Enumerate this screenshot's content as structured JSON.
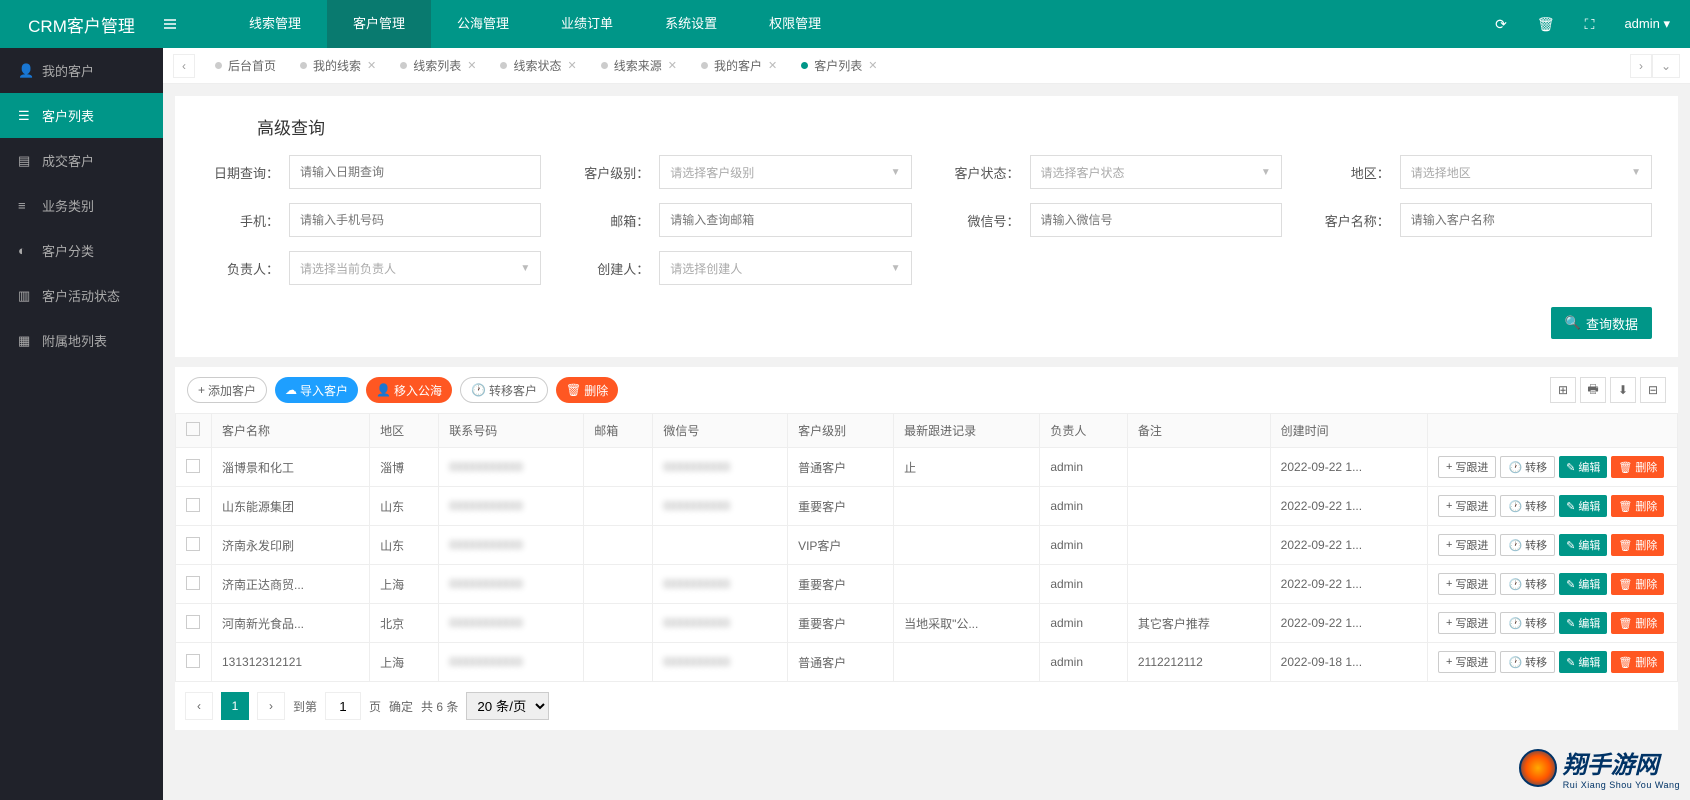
{
  "brand": "CRM客户管理",
  "topNav": [
    "线索管理",
    "客户管理",
    "公海管理",
    "业绩订单",
    "系统设置",
    "权限管理"
  ],
  "topNavActive": 1,
  "admin": "admin ▾",
  "sidebar": [
    {
      "icon": "user",
      "label": "我的客户"
    },
    {
      "icon": "list",
      "label": "客户列表"
    },
    {
      "icon": "deal",
      "label": "成交客户"
    },
    {
      "icon": "biz",
      "label": "业务类别"
    },
    {
      "icon": "cat",
      "label": "客户分类"
    },
    {
      "icon": "activity",
      "label": "客户活动状态"
    },
    {
      "icon": "attach",
      "label": "附属地列表"
    }
  ],
  "sidebarActive": 1,
  "tabs": [
    "后台首页",
    "我的线索",
    "线索列表",
    "线索状态",
    "线索来源",
    "我的客户",
    "客户列表"
  ],
  "tabActive": 6,
  "search": {
    "title": "高级查询",
    "fields": {
      "date": {
        "label": "日期查询：",
        "ph": "请输入日期查询"
      },
      "level": {
        "label": "客户级别：",
        "ph": "请选择客户级别"
      },
      "status": {
        "label": "客户状态：",
        "ph": "请选择客户状态"
      },
      "region": {
        "label": "地区：",
        "ph": "请选择地区"
      },
      "phone": {
        "label": "手机：",
        "ph": "请输入手机号码"
      },
      "email": {
        "label": "邮箱：",
        "ph": "请输入查询邮箱"
      },
      "wechat": {
        "label": "微信号：",
        "ph": "请输入微信号"
      },
      "name": {
        "label": "客户名称：",
        "ph": "请输入客户名称"
      },
      "owner": {
        "label": "负责人：",
        "ph": "请选择当前负责人"
      },
      "creator": {
        "label": "创建人：",
        "ph": "请选择创建人"
      }
    },
    "searchBtn": "查询数据"
  },
  "toolbar": {
    "add": "添加客户",
    "import": "导入客户",
    "toPublic": "移入公海",
    "transfer": "转移客户",
    "delete": "删除"
  },
  "table": {
    "headers": [
      "客户名称",
      "地区",
      "联系号码",
      "邮箱",
      "微信号",
      "客户级别",
      "最新跟进记录",
      "负责人",
      "备注",
      "创建时间"
    ],
    "rows": [
      {
        "name": "淄博景和化工",
        "region": "淄博",
        "phone": "···",
        "email": "",
        "wechat": "···",
        "level": "普通客户",
        "follow": "止",
        "owner": "admin",
        "remark": "",
        "created": "2022-09-22 1..."
      },
      {
        "name": "山东能源集团",
        "region": "山东",
        "phone": "···",
        "email": "",
        "wechat": "···",
        "level": "重要客户",
        "follow": "",
        "owner": "admin",
        "remark": "",
        "created": "2022-09-22 1..."
      },
      {
        "name": "济南永发印刷",
        "region": "山东",
        "phone": "···",
        "email": "",
        "wechat": "",
        "level": "VIP客户",
        "follow": "",
        "owner": "admin",
        "remark": "",
        "created": "2022-09-22 1..."
      },
      {
        "name": "济南正达商贸...",
        "region": "上海",
        "phone": "···",
        "email": "",
        "wechat": "···",
        "level": "重要客户",
        "follow": "",
        "owner": "admin",
        "remark": "",
        "created": "2022-09-22 1..."
      },
      {
        "name": "河南新光食品...",
        "region": "北京",
        "phone": "···",
        "email": "",
        "wechat": "···",
        "level": "重要客户",
        "follow": "当地采取\"公...",
        "owner": "admin",
        "remark": "其它客户推荐",
        "created": "2022-09-22 1..."
      },
      {
        "name": "131312312121",
        "region": "上海",
        "phone": "···",
        "email": "",
        "wechat": "···",
        "level": "普通客户",
        "follow": "",
        "owner": "admin",
        "remark": "2112212112",
        "created": "2022-09-18 1..."
      }
    ],
    "actions": {
      "follow": "写跟进",
      "transfer": "转移",
      "edit": "编辑",
      "delete": "删除"
    }
  },
  "pagination": {
    "current": "1",
    "goto": "到第",
    "gotoVal": "1",
    "pageLabel": "页",
    "confirm": "确定",
    "total": "共 6 条",
    "perPage": "20 条/页"
  },
  "watermark": {
    "cn": "翔手游网",
    "en": "Rui Xiang Shou You Wang"
  }
}
